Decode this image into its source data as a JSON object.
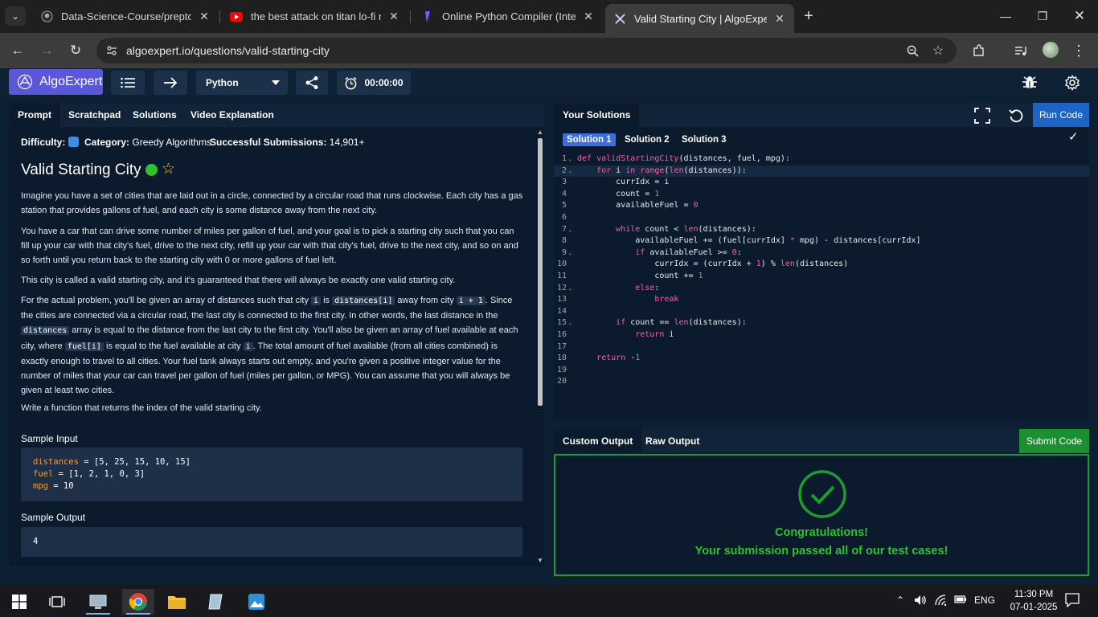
{
  "browser": {
    "tabs": [
      {
        "title": "Data-Science-Course/preptopic"
      },
      {
        "title": "the best attack on titan lo-fi mix"
      },
      {
        "title": "Online Python Compiler (Interpreter)"
      },
      {
        "title": "Valid Starting City | AlgoExpert"
      }
    ],
    "url": "algoexpert.io/questions/valid-starting-city"
  },
  "toolbar": {
    "logo": "AlgoExpert",
    "language": "Python",
    "timer": "00:00:00"
  },
  "left_tabs": [
    "Prompt",
    "Scratchpad",
    "Solutions",
    "Video Explanation"
  ],
  "meta": {
    "difficulty_label": "Difficulty:",
    "category_label": "Category:",
    "category_value": "Greedy Algorithms",
    "submissions_label": "Successful Submissions:",
    "submissions_value": "14,901+"
  },
  "question": {
    "title": "Valid Starting City",
    "p1": "Imagine you have a set of cities that are laid out in a circle, connected by a circular road that runs clockwise. Each city has a gas station that provides gallons of fuel, and each city is some distance away from the next city.",
    "p2": "You have a car that can drive some number of miles per gallon of fuel, and your goal is to pick a starting city such that you can fill up your car with that city's fuel, drive to the next city, refill up your car with that city's fuel, drive to the next city, and so on and so forth until you return back to the starting city with 0 or more gallons of fuel left.",
    "p3": "This city is called a valid starting city, and it's guaranteed that there will always be exactly one valid starting city.",
    "p4": {
      "t1": "For the actual problem, you'll be given an array of distances such that city ",
      "c1": "i",
      "t2": " is ",
      "c2": "distances[i]",
      "t3": " away from city ",
      "c3": "i + 1",
      "t4": ". Since the cities are connected via a circular road, the last city is connected to the first city. In other words, the last distance in the ",
      "c4": "distances",
      "t5": " array is equal to the distance from the last city to the first city. You'll also be given an array of fuel available at each city, where ",
      "c5": "fuel[i]",
      "t6": " is equal to the fuel available at city ",
      "c6": "i",
      "t7": ". The total amount of fuel available (from all cities combined) is exactly enough to travel to all cities. Your fuel tank always starts out empty, and you're given a positive integer value for the number of miles that your car can travel per gallon of fuel (miles per gallon, or MPG). You can assume that you will always be given at least two cities."
    },
    "p5": "Write a function that returns the index of the valid starting city.",
    "sample_input_label": "Sample Input",
    "sample_input": [
      {
        "var": "distances",
        "rest": " = [5, 25, 15, 10, 15]"
      },
      {
        "var": "fuel",
        "rest": " = [1, 2, 1, 0, 3]"
      },
      {
        "var": "mpg",
        "rest": " = 10"
      }
    ],
    "sample_output_label": "Sample Output",
    "sample_output": "4"
  },
  "editor": {
    "tab": "Your Solutions",
    "run_label": "Run Code",
    "solution_tabs": [
      "Solution 1",
      "Solution 2",
      "Solution 3"
    ],
    "lines": [
      "1",
      "2",
      "3",
      "4",
      "5",
      "6",
      "7",
      "8",
      "9",
      "10",
      "11",
      "12",
      "13",
      "14",
      "15",
      "16",
      "17",
      "18",
      "19",
      "20"
    ]
  },
  "output": {
    "tabs": [
      "Custom Output",
      "Raw Output"
    ],
    "submit_label": "Submit Code",
    "title": "Congratulations!",
    "message": "Your submission passed all of our test cases!"
  },
  "taskbar": {
    "language": "ENG",
    "time": "11:30 PM",
    "date": "07-01-2025"
  },
  "colors": {
    "brand": "#5a57d9",
    "run": "#1c65c7",
    "submit": "#1d8f33",
    "success": "#2ec22e"
  }
}
